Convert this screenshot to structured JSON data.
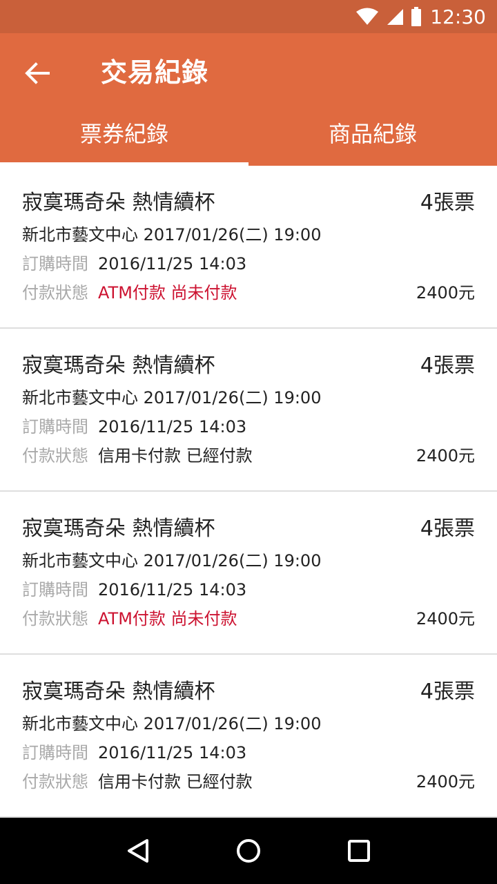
{
  "status_bar": {
    "time": "12:30"
  },
  "header": {
    "title": "交易紀錄",
    "back_icon": "arrow-back-icon"
  },
  "tabs": [
    {
      "label": "票券紀錄",
      "active": true
    },
    {
      "label": "商品紀錄",
      "active": false
    }
  ],
  "labels": {
    "order_time": "訂購時間",
    "payment_status": "付款狀態"
  },
  "records": [
    {
      "name": "寂寞瑪奇朵  熱情續杯",
      "qty": "4張票",
      "venue": "新北市藝文中心  2017/01/26(二) 19:00",
      "order_time": "2016/11/25 14:03",
      "payment": "ATM付款 尚未付款",
      "paid": false,
      "price": "2400元"
    },
    {
      "name": "寂寞瑪奇朵  熱情續杯",
      "qty": "4張票",
      "venue": "新北市藝文中心  2017/01/26(二) 19:00",
      "order_time": "2016/11/25 14:03",
      "payment": "信用卡付款 已經付款",
      "paid": true,
      "price": "2400元"
    },
    {
      "name": "寂寞瑪奇朵  熱情續杯",
      "qty": "4張票",
      "venue": "新北市藝文中心  2017/01/26(二) 19:00",
      "order_time": "2016/11/25 14:03",
      "payment": "ATM付款 尚未付款",
      "paid": false,
      "price": "2400元"
    },
    {
      "name": "寂寞瑪奇朵  熱情續杯",
      "qty": "4張票",
      "venue": "新北市藝文中心  2017/01/26(二) 19:00",
      "order_time": "2016/11/25 14:03",
      "payment": "信用卡付款 已經付款",
      "paid": true,
      "price": "2400元"
    }
  ],
  "colors": {
    "status_bar": "#c9603a",
    "app_bar": "#e06a40",
    "unpaid": "#cc1230",
    "label_gray": "#a9a9a9"
  }
}
